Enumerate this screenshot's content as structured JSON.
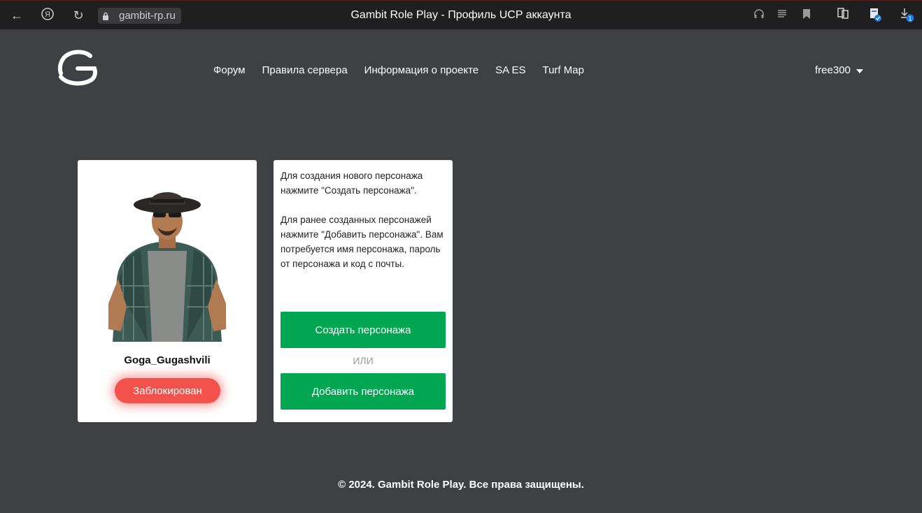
{
  "browser": {
    "url": "gambit-rp.ru",
    "title": "Gambit Role Play - Профиль UCP аккаунта",
    "download_badge": "1"
  },
  "nav": {
    "items": [
      "Форум",
      "Правила сервера",
      "Информация о проекте",
      "SA ES",
      "Turf Map"
    ]
  },
  "user": {
    "name": "free300"
  },
  "character": {
    "name": "Goga_Gugashvili",
    "status": "Заблокирован"
  },
  "info": {
    "paragraph1": "Для создания нового персонажа нажмите \"Создать персонажа\".",
    "paragraph2": "Для ранее созданных персонажей нажмите \"Добавить персонажа\". Вам потребуется имя персонажа, пароль от персонажа и код с почты.",
    "create_label": "Создать персонажа",
    "or_label": "ИЛИ",
    "add_label": "Добавить персонажа"
  },
  "footer": {
    "text": "© 2024. Gambit Role Play. Все права защищены."
  },
  "colors": {
    "background": "#3f4044",
    "accent_green": "#00a651",
    "status_red": "#f2514c"
  }
}
